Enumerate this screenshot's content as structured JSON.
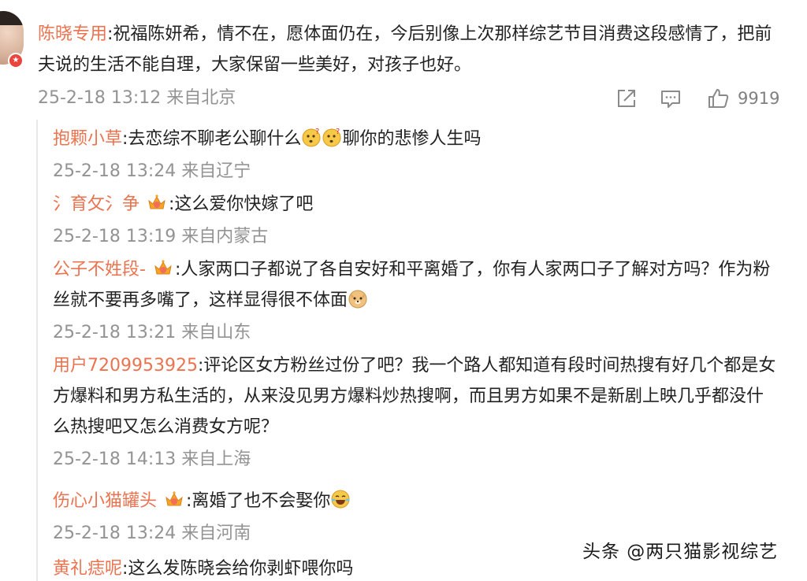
{
  "main_comment": {
    "username": "陈晓专用",
    "text": ":祝福陈妍希，情不在，愿体面仍在，今后别像上次那样综艺节目消费这段感情了，把前夫说的生活不能自理，大家保留一些美好，对孩子也好。",
    "meta": "25-2-18 13:12 来自北京",
    "like_count": "9919",
    "icons": [
      "share-icon",
      "comment-icon",
      "like-icon"
    ]
  },
  "replies": [
    {
      "username": "抱颗小草",
      "text_before": ":去恋综不聊老公聊什么",
      "text_after": "聊你的悲惨人生吗",
      "meta": "25-2-18 13:24 来自辽宁"
    },
    {
      "username": "氵育攵氵争",
      "text": ":这么爱你快嫁了吧",
      "meta": "25-2-18 13:19 来自内蒙古"
    },
    {
      "username": "公子不姓段-",
      "text": ":人家两口子都说了各自安好和平离婚了，你有人家两口子了解对方吗？作为粉丝就不要再多嘴了，这样显得很不体面",
      "meta": "25-2-18 13:21 来自山东"
    },
    {
      "username": "用户7209953925",
      "text": ":评论区女方粉丝过份了吧？我一个路人都知道有段时间热搜有好几个都是女方爆料和男方私生活的，从来没见男方爆料炒热搜啊，而且男方如果不是新剧上映几乎都没什么热搜吧又怎么消费女方呢？",
      "meta": "25-2-18 14:13 来自上海"
    },
    {
      "username": "伤心小猫罐头",
      "text": ":离婚了也不会娶你",
      "meta": "25-2-18 13:24 来自河南"
    },
    {
      "username": "黄礼痣呢",
      "text": ":这么发陈晓会给你剥虾喂你吗"
    }
  ],
  "watermark": "头条 @两只猫影视综艺",
  "colors": {
    "username": "#eb7350",
    "text": "#222222",
    "meta": "#939393",
    "thread_line": "#e9e9e9"
  }
}
